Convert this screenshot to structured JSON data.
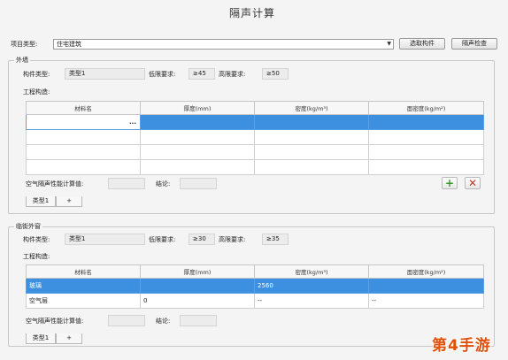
{
  "window": {
    "title": "隔声计算"
  },
  "project": {
    "label": "项目类型:",
    "value": "住宅建筑",
    "select_button": "选取构件",
    "check_button": "隔声检查"
  },
  "outer_wall": {
    "title": "外墙",
    "type_label": "构件类型:",
    "type_value": "类型1",
    "min_req_label": "低限要求:",
    "min_req_value": "≥45",
    "high_req_label": "高限要求:",
    "high_req_value": "≥50",
    "construction_label": "工程构造:",
    "columns": [
      "材料名",
      "厚度(mm)",
      "密度(kg/m³)",
      "面密度(kg/m²)"
    ],
    "rows": [
      {
        "material": "",
        "thickness": "",
        "density": "",
        "area_density": "",
        "selected": true
      },
      {
        "material": "",
        "thickness": "",
        "density": "",
        "area_density": ""
      },
      {
        "material": "",
        "thickness": "",
        "density": "",
        "area_density": ""
      },
      {
        "material": "",
        "thickness": "",
        "density": "",
        "area_density": ""
      }
    ],
    "ellipsis": "...",
    "calc_label": "空气隔声性能计算值:",
    "calc_value": "",
    "conclusion_label": "结论:",
    "conclusion_value": "",
    "tab_label": "类型1",
    "tab_add": "+"
  },
  "street_window": {
    "title": "临街外窗",
    "type_label": "构件类型:",
    "type_value": "类型1",
    "min_req_label": "低限要求:",
    "min_req_value": "≥30",
    "high_req_label": "高限要求:",
    "high_req_value": "≥35",
    "construction_label": "工程构造:",
    "columns": [
      "材料名",
      "厚度(mm)",
      "密度(kg/m³)",
      "面密度(kg/m²)"
    ],
    "rows": [
      {
        "material": "玻璃",
        "thickness": "",
        "density": "2560",
        "area_density": "",
        "selected": true
      },
      {
        "material": "空气层",
        "thickness": "0",
        "density": "--",
        "area_density": "--"
      }
    ],
    "calc_label": "空气隔声性能计算值:",
    "calc_value": "",
    "conclusion_label": "结论:",
    "conclusion_value": "",
    "tab_label": "类型1",
    "tab_add": "+"
  },
  "icons": {
    "add": "plus-icon",
    "delete": "delete-icon",
    "add_color": "#3a9a2a",
    "delete_color": "#c43a2a"
  },
  "watermark": "第4手游"
}
